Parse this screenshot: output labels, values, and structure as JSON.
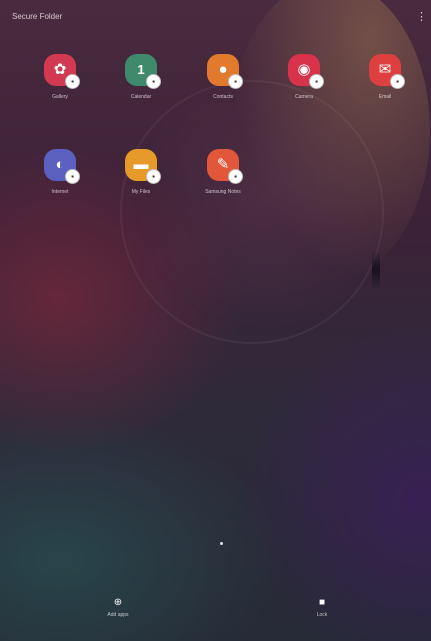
{
  "header": {
    "folder_title": "Secure Folder",
    "more_icon": "more-vertical-icon"
  },
  "apps": [
    {
      "name": "Gallery",
      "icon": "gallery-icon",
      "color": "#d33a52"
    },
    {
      "name": "Calendar",
      "icon": "calendar-icon",
      "color": "#3f8a6d"
    },
    {
      "name": "Contacts",
      "icon": "contacts-icon",
      "color": "#e27a2e"
    },
    {
      "name": "Camera",
      "icon": "camera-icon",
      "color": "#d8334a"
    },
    {
      "name": "Email",
      "icon": "email-icon",
      "color": "#de3f3f"
    },
    {
      "name": "Internet",
      "icon": "internet-icon",
      "color": "#5a5fc0"
    },
    {
      "name": "My Files",
      "icon": "folder-icon",
      "color": "#e59a2a"
    },
    {
      "name": "Samsung Notes",
      "icon": "notes-icon",
      "color": "#e2573a"
    }
  ],
  "dock": {
    "add_apps_label": "Add apps",
    "lock_label": "Lock"
  }
}
